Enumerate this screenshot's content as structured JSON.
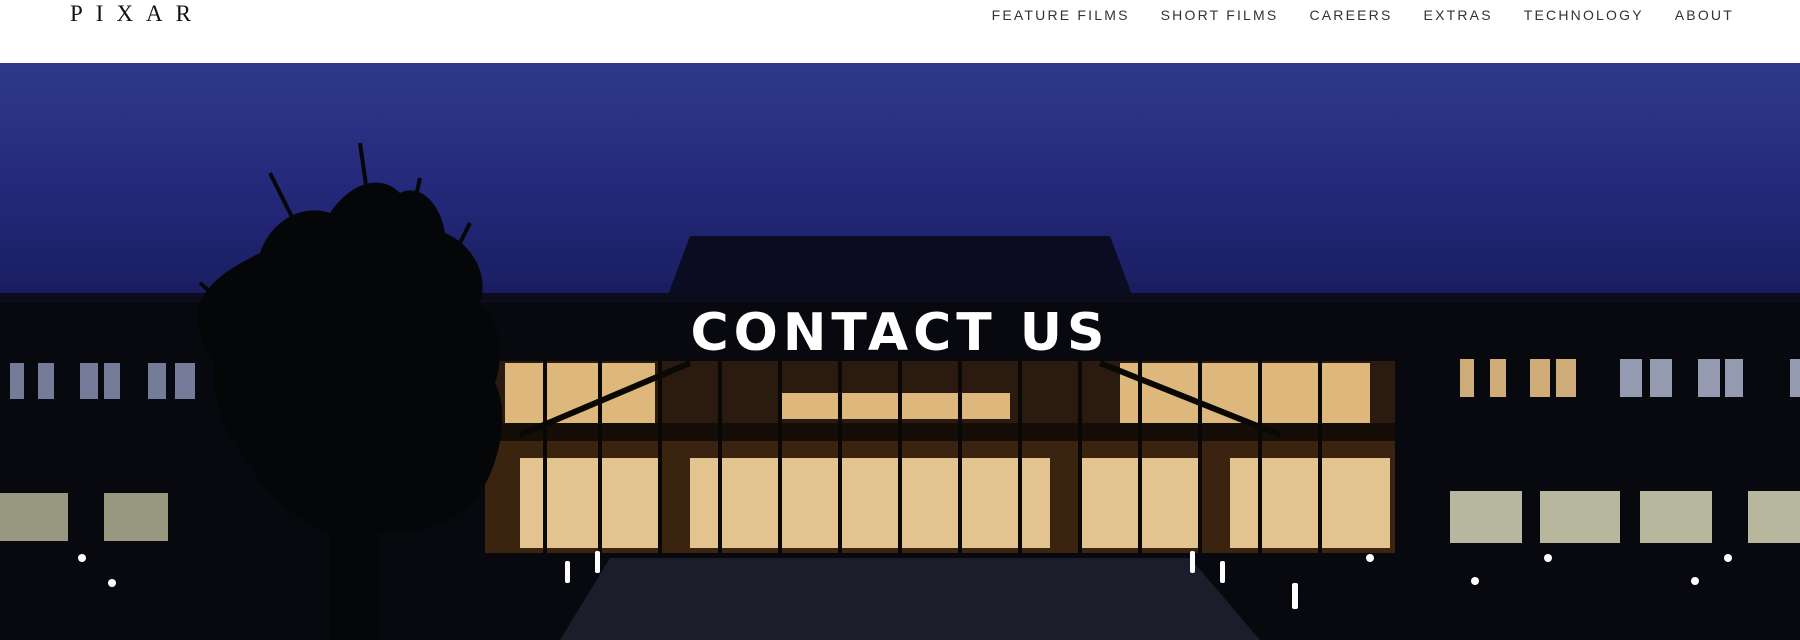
{
  "header": {
    "logo": "PIXAR",
    "nav": [
      {
        "label": "FEATURE FILMS"
      },
      {
        "label": "SHORT FILMS"
      },
      {
        "label": "CAREERS"
      },
      {
        "label": "EXTRAS"
      },
      {
        "label": "TECHNOLOGY"
      },
      {
        "label": "ABOUT"
      }
    ]
  },
  "hero": {
    "title": "CONTACT US",
    "image": "pixar-campus-building-at-night",
    "colors": {
      "sky_top": "#2f3a8a",
      "sky_bottom": "#1b1f63",
      "window_light": "#f2c98a"
    }
  }
}
